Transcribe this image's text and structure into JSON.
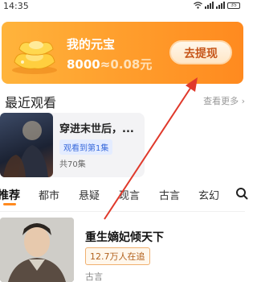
{
  "status_bar": {
    "time": "14:35",
    "battery": "35"
  },
  "banner": {
    "title": "我的元宝",
    "coins": "8000",
    "approx": "≈",
    "rmb": "0.08元",
    "withdraw_label": "去提现"
  },
  "recent": {
    "section_title": "最近观看",
    "see_more": "查看更多 ›",
    "item": {
      "title": "穿进末世后，...",
      "progress": "观看到第1集",
      "total": "共70集"
    }
  },
  "categories": {
    "tabs": [
      "推荐",
      "都市",
      "悬疑",
      "现言",
      "古言",
      "玄幻"
    ],
    "active_index": 0
  },
  "book": {
    "title": "重生嫡妃倾天下",
    "badge": "12.7万人在追",
    "genre": "古言"
  },
  "colors": {
    "accent": "#ff8a1f",
    "annotation_arrow": "#e0392b"
  }
}
